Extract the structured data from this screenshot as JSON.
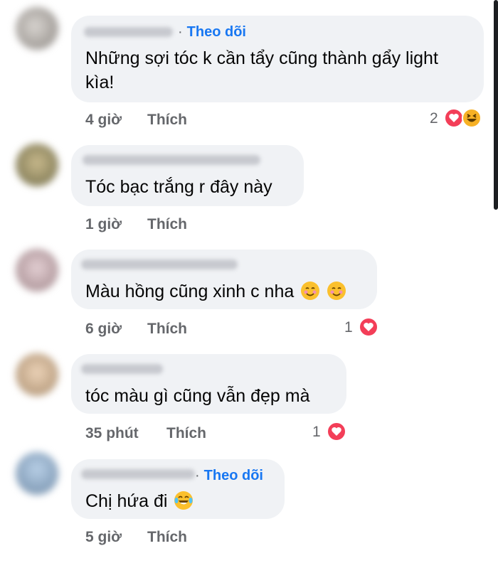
{
  "comments": [
    {
      "follow_label": "Theo dõi",
      "text_line1": "Những sợi tóc k cần tẩy cũng thành gẩy light",
      "text_line2": "kìa!",
      "time": "4 giờ",
      "like_label": "Thích",
      "reaction_count": "2"
    },
    {
      "text": "Tóc bạc trắng r đây này",
      "time": "1 giờ",
      "like_label": "Thích"
    },
    {
      "text": "Màu hồng cũng xinh c nha",
      "time": "6 giờ",
      "like_label": "Thích",
      "reaction_count": "1"
    },
    {
      "text": "tóc màu gì cũng vẫn đẹp mà",
      "time": "35 phút",
      "like_label": "Thích",
      "reaction_count": "1"
    },
    {
      "follow_label": "Theo dõi",
      "text": "Chị hứa đi",
      "time": "5 giờ",
      "like_label": "Thích"
    }
  ],
  "colors": {
    "follow": "#1877f2",
    "bubble": "#f0f2f5",
    "meta": "#65676b",
    "love": "#f33e58",
    "haha": "#f7b125"
  },
  "icons": {
    "love": "heart-reaction-icon",
    "haha": "laugh-reaction-icon",
    "smile": "smiling-face-icon",
    "cry_laugh": "tears-of-joy-icon"
  }
}
